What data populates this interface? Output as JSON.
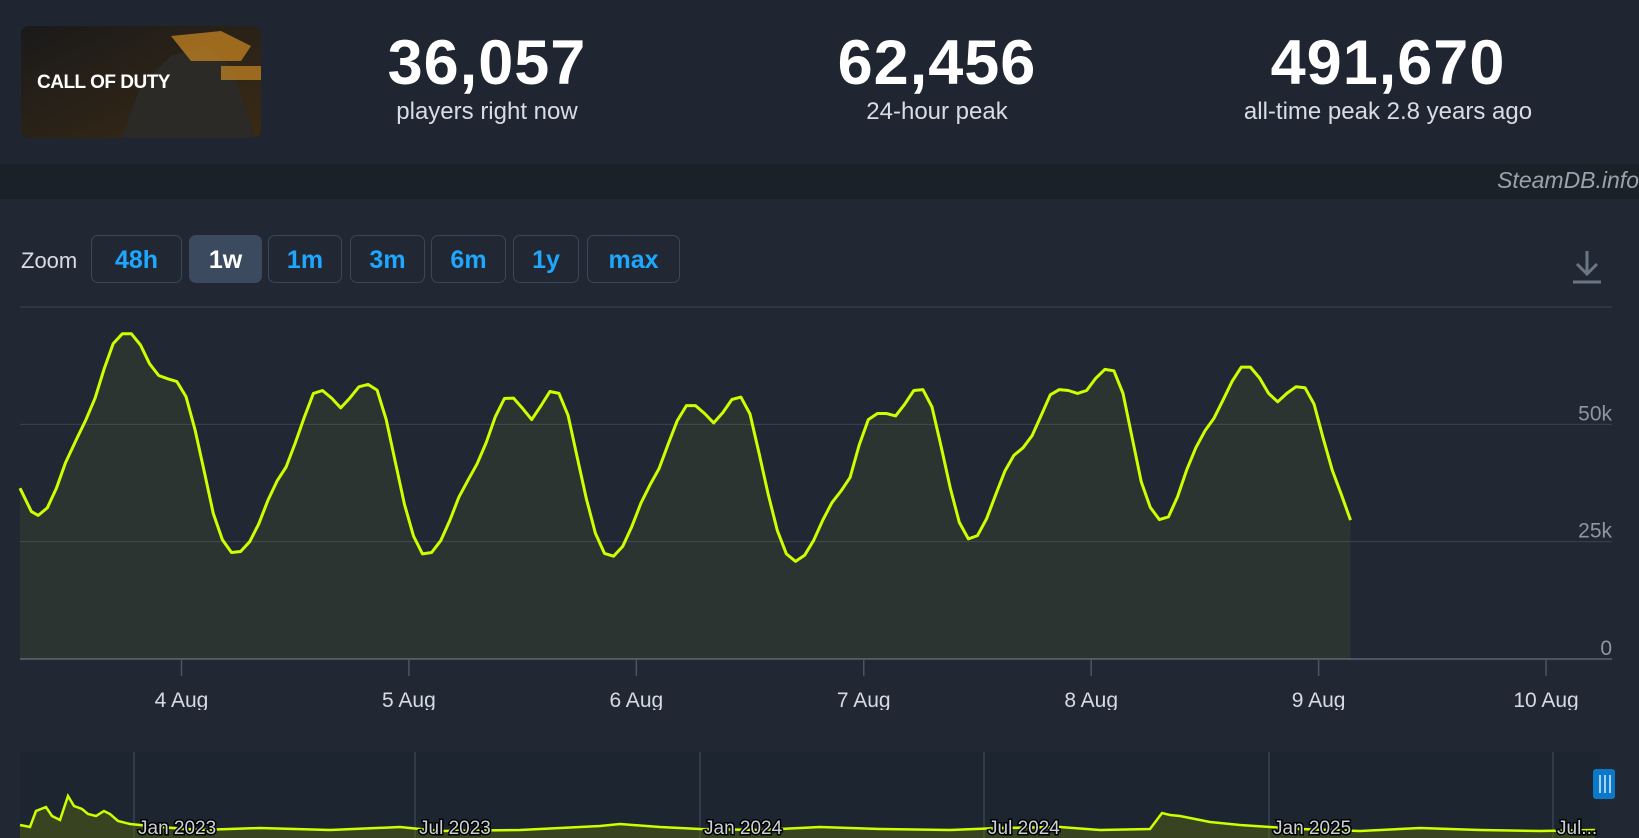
{
  "logo": {
    "text": "CALL OF DUTY"
  },
  "stats": [
    {
      "value": "36,057",
      "label": "players right now"
    },
    {
      "value": "62,456",
      "label": "24-hour peak"
    },
    {
      "value": "491,670",
      "label": "all-time peak 2.8 years ago"
    }
  ],
  "watermark": "SteamDB.info",
  "zoom": {
    "label": "Zoom",
    "options": [
      "48h",
      "1w",
      "1m",
      "3m",
      "6m",
      "1y",
      "max"
    ],
    "selected": "1w"
  },
  "download_icon": "download-icon",
  "colors": {
    "line": "#ccff00",
    "accent": "#1ea7ff",
    "background": "#212834"
  },
  "chart_data": {
    "type": "line",
    "title": "",
    "xlabel": "",
    "ylabel": "",
    "ylim": [
      0,
      75000
    ],
    "y_ticks": [
      {
        "label": "0",
        "value": 0
      },
      {
        "label": "25k",
        "value": 25000
      },
      {
        "label": "50k",
        "value": 50000
      }
    ],
    "x_ticks": [
      {
        "label": "4 Aug",
        "day": 1
      },
      {
        "label": "5 Aug",
        "day": 2
      },
      {
        "label": "6 Aug",
        "day": 3
      },
      {
        "label": "7 Aug",
        "day": 4
      },
      {
        "label": "8 Aug",
        "day": 5
      },
      {
        "label": "9 Aug",
        "day": 6
      },
      {
        "label": "10 Aug",
        "day": 7
      }
    ],
    "xlim": [
      0.29,
      7.29
    ],
    "series": [
      {
        "values": [
          [
            0.29,
            36400
          ],
          [
            0.34,
            31400
          ],
          [
            0.37,
            30600
          ],
          [
            0.41,
            32200
          ],
          [
            0.45,
            36400
          ],
          [
            0.49,
            41800
          ],
          [
            0.54,
            47000
          ],
          [
            0.58,
            51000
          ],
          [
            0.62,
            55600
          ],
          [
            0.66,
            61800
          ],
          [
            0.7,
            67200
          ],
          [
            0.74,
            69300
          ],
          [
            0.78,
            69300
          ],
          [
            0.82,
            66900
          ],
          [
            0.86,
            62900
          ],
          [
            0.9,
            60400
          ],
          [
            0.94,
            59700
          ],
          [
            0.98,
            59100
          ],
          [
            1.02,
            55900
          ],
          [
            1.06,
            48800
          ],
          [
            1.1,
            40000
          ],
          [
            1.14,
            31000
          ],
          [
            1.18,
            25400
          ],
          [
            1.22,
            22700
          ],
          [
            1.26,
            22900
          ],
          [
            1.3,
            25000
          ],
          [
            1.34,
            28800
          ],
          [
            1.38,
            33800
          ],
          [
            1.42,
            37900
          ],
          [
            1.46,
            40900
          ],
          [
            1.5,
            46000
          ],
          [
            1.54,
            51500
          ],
          [
            1.58,
            56600
          ],
          [
            1.62,
            57200
          ],
          [
            1.66,
            55600
          ],
          [
            1.7,
            53500
          ],
          [
            1.74,
            55600
          ],
          [
            1.78,
            58000
          ],
          [
            1.82,
            58500
          ],
          [
            1.86,
            57300
          ],
          [
            1.9,
            51000
          ],
          [
            1.94,
            42000
          ],
          [
            1.98,
            33000
          ],
          [
            2.02,
            26200
          ],
          [
            2.06,
            22400
          ],
          [
            2.1,
            22700
          ],
          [
            2.14,
            25200
          ],
          [
            2.18,
            29500
          ],
          [
            2.22,
            34500
          ],
          [
            2.26,
            38100
          ],
          [
            2.3,
            41600
          ],
          [
            2.34,
            46100
          ],
          [
            2.38,
            51600
          ],
          [
            2.42,
            55500
          ],
          [
            2.46,
            55600
          ],
          [
            2.5,
            53400
          ],
          [
            2.54,
            51000
          ],
          [
            2.58,
            53900
          ],
          [
            2.62,
            57000
          ],
          [
            2.66,
            56600
          ],
          [
            2.7,
            51900
          ],
          [
            2.74,
            43000
          ],
          [
            2.78,
            34200
          ],
          [
            2.82,
            26800
          ],
          [
            2.86,
            22500
          ],
          [
            2.9,
            21900
          ],
          [
            2.94,
            24000
          ],
          [
            2.98,
            28200
          ],
          [
            3.02,
            33200
          ],
          [
            3.06,
            37100
          ],
          [
            3.1,
            40600
          ],
          [
            3.14,
            45800
          ],
          [
            3.18,
            50800
          ],
          [
            3.22,
            54000
          ],
          [
            3.26,
            54000
          ],
          [
            3.3,
            52300
          ],
          [
            3.34,
            50300
          ],
          [
            3.38,
            52500
          ],
          [
            3.42,
            55300
          ],
          [
            3.46,
            55800
          ],
          [
            3.5,
            52200
          ],
          [
            3.54,
            43800
          ],
          [
            3.58,
            35100
          ],
          [
            3.62,
            27400
          ],
          [
            3.66,
            22400
          ],
          [
            3.7,
            20800
          ],
          [
            3.74,
            22100
          ],
          [
            3.78,
            25300
          ],
          [
            3.82,
            29600
          ],
          [
            3.86,
            33300
          ],
          [
            3.9,
            35800
          ],
          [
            3.94,
            38700
          ],
          [
            3.98,
            45600
          ],
          [
            4.02,
            51000
          ],
          [
            4.06,
            52300
          ],
          [
            4.1,
            52300
          ],
          [
            4.14,
            51800
          ],
          [
            4.18,
            54300
          ],
          [
            4.22,
            57200
          ],
          [
            4.26,
            57400
          ],
          [
            4.3,
            53700
          ],
          [
            4.34,
            45300
          ],
          [
            4.38,
            36500
          ],
          [
            4.42,
            29100
          ],
          [
            4.46,
            25600
          ],
          [
            4.5,
            26300
          ],
          [
            4.54,
            29900
          ],
          [
            4.58,
            35000
          ],
          [
            4.62,
            40000
          ],
          [
            4.66,
            43400
          ],
          [
            4.7,
            45000
          ],
          [
            4.74,
            47600
          ],
          [
            4.78,
            51900
          ],
          [
            4.82,
            56300
          ],
          [
            4.86,
            57400
          ],
          [
            4.9,
            57200
          ],
          [
            4.94,
            56600
          ],
          [
            4.98,
            57200
          ],
          [
            5.02,
            59800
          ],
          [
            5.06,
            61700
          ],
          [
            5.1,
            61400
          ],
          [
            5.14,
            56600
          ],
          [
            5.18,
            47200
          ],
          [
            5.22,
            37800
          ],
          [
            5.26,
            32300
          ],
          [
            5.3,
            29700
          ],
          [
            5.34,
            30300
          ],
          [
            5.38,
            34600
          ],
          [
            5.42,
            40300
          ],
          [
            5.46,
            45000
          ],
          [
            5.5,
            48600
          ],
          [
            5.54,
            51300
          ],
          [
            5.58,
            55200
          ],
          [
            5.62,
            59200
          ],
          [
            5.66,
            62200
          ],
          [
            5.7,
            62200
          ],
          [
            5.74,
            59900
          ],
          [
            5.78,
            56600
          ],
          [
            5.82,
            54800
          ],
          [
            5.86,
            56600
          ],
          [
            5.9,
            58000
          ],
          [
            5.94,
            57800
          ],
          [
            5.98,
            54300
          ],
          [
            6.02,
            47000
          ],
          [
            6.06,
            40200
          ],
          [
            6.1,
            35000
          ],
          [
            6.14,
            29600
          ]
        ]
      }
    ],
    "navigator": {
      "x_labels": [
        "Jan 2023",
        "Jul 2023",
        "Jan 2024",
        "Jul 2024",
        "Jan 2025",
        "Jul..."
      ]
    }
  }
}
